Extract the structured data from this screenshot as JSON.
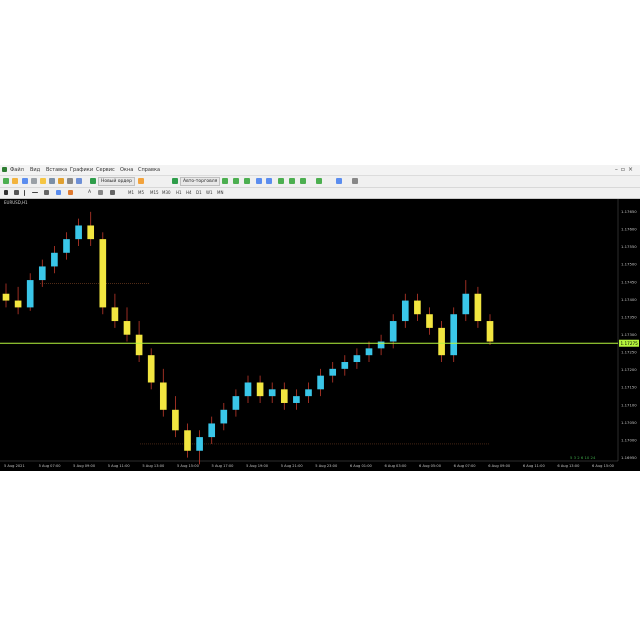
{
  "menu": {
    "items": [
      "Файл",
      "Вид",
      "Вставка",
      "Графики",
      "Сервис",
      "Окна",
      "Справка"
    ]
  },
  "toolbar": {
    "new_order_label": "Новый ордер",
    "autotrading_label": "Авто-торговля",
    "timeframes": [
      "M1",
      "M5",
      "M15",
      "M30",
      "H1",
      "H4",
      "D1",
      "W1",
      "MN"
    ]
  },
  "chart": {
    "title": "EURUSD,H1",
    "current_price": "1.17275",
    "price_labels": [
      "1.17650",
      "1.17600",
      "1.17550",
      "1.17500",
      "1.17450",
      "1.17400",
      "1.17350",
      "1.17300",
      "1.17250",
      "1.17200",
      "1.17150",
      "1.17100",
      "1.17050",
      "1.17000",
      "1.16950"
    ],
    "time_labels": [
      "5 Aug 2021",
      "5 Aug 07:00",
      "5 Aug 09:00",
      "5 Aug 11:00",
      "5 Aug 13:00",
      "5 Aug 15:00",
      "5 Aug 17:00",
      "5 Aug 19:00",
      "5 Aug 21:00",
      "5 Aug 23:00",
      "6 Aug 01:00",
      "6 Aug 03:00",
      "6 Aug 05:00",
      "6 Aug 07:00",
      "6 Aug 09:00",
      "6 Aug 11:00",
      "6 Aug 13:00",
      "6 Aug 15:00"
    ],
    "corner_marks": "5  3  2  6  10  24",
    "colors": {
      "background": "#000000",
      "bull": "#3ac6e8",
      "bear": "#f2e640",
      "wick": "#c0392b",
      "price_line": "#b5f53d",
      "level_line": "#6b3a1f"
    }
  },
  "chart_data": {
    "type": "candlestick",
    "series": [
      {
        "values": [
          [
            1.1742,
            1.1745,
            1.1738,
            1.174
          ],
          [
            1.174,
            1.1744,
            1.1736,
            1.1738
          ],
          [
            1.1738,
            1.1748,
            1.1737,
            1.1746
          ],
          [
            1.1746,
            1.1752,
            1.1744,
            1.175
          ],
          [
            1.175,
            1.1756,
            1.1748,
            1.1754
          ],
          [
            1.1754,
            1.176,
            1.1752,
            1.1758
          ],
          [
            1.1758,
            1.1764,
            1.1756,
            1.1762
          ],
          [
            1.1762,
            1.1766,
            1.1756,
            1.1758
          ],
          [
            1.1758,
            1.176,
            1.1736,
            1.1738
          ],
          [
            1.1738,
            1.1742,
            1.1732,
            1.1734
          ],
          [
            1.1734,
            1.1738,
            1.1728,
            1.173
          ],
          [
            1.173,
            1.1734,
            1.1722,
            1.1724
          ],
          [
            1.1724,
            1.1726,
            1.1714,
            1.1716
          ],
          [
            1.1716,
            1.172,
            1.1706,
            1.1708
          ],
          [
            1.1708,
            1.1712,
            1.17,
            1.1702
          ],
          [
            1.1702,
            1.1704,
            1.1694,
            1.1696
          ],
          [
            1.1696,
            1.1702,
            1.1692,
            1.17
          ],
          [
            1.17,
            1.1706,
            1.1698,
            1.1704
          ],
          [
            1.1704,
            1.171,
            1.1702,
            1.1708
          ],
          [
            1.1708,
            1.1714,
            1.1706,
            1.1712
          ],
          [
            1.1712,
            1.1718,
            1.171,
            1.1716
          ],
          [
            1.1716,
            1.1718,
            1.171,
            1.1712
          ],
          [
            1.1712,
            1.1716,
            1.171,
            1.1714
          ],
          [
            1.1714,
            1.1716,
            1.1708,
            1.171
          ],
          [
            1.171,
            1.1714,
            1.1708,
            1.1712
          ],
          [
            1.1712,
            1.1716,
            1.171,
            1.1714
          ],
          [
            1.1714,
            1.172,
            1.1712,
            1.1718
          ],
          [
            1.1718,
            1.1722,
            1.1716,
            1.172
          ],
          [
            1.172,
            1.1724,
            1.1718,
            1.1722
          ],
          [
            1.1722,
            1.1726,
            1.172,
            1.1724
          ],
          [
            1.1724,
            1.1728,
            1.1722,
            1.1726
          ],
          [
            1.1726,
            1.173,
            1.1724,
            1.1728
          ],
          [
            1.1728,
            1.1736,
            1.1726,
            1.1734
          ],
          [
            1.1734,
            1.1742,
            1.1732,
            1.174
          ],
          [
            1.174,
            1.1742,
            1.1734,
            1.1736
          ],
          [
            1.1736,
            1.1738,
            1.173,
            1.1732
          ],
          [
            1.1732,
            1.1734,
            1.1722,
            1.1724
          ],
          [
            1.1724,
            1.1738,
            1.1722,
            1.1736
          ],
          [
            1.1736,
            1.1746,
            1.1734,
            1.1742
          ],
          [
            1.1742,
            1.1744,
            1.1732,
            1.1734
          ],
          [
            1.1734,
            1.1736,
            1.1727,
            1.1728
          ]
        ]
      }
    ],
    "ylim": [
      1.1693,
      1.1768
    ],
    "current_price": 1.17275
  }
}
